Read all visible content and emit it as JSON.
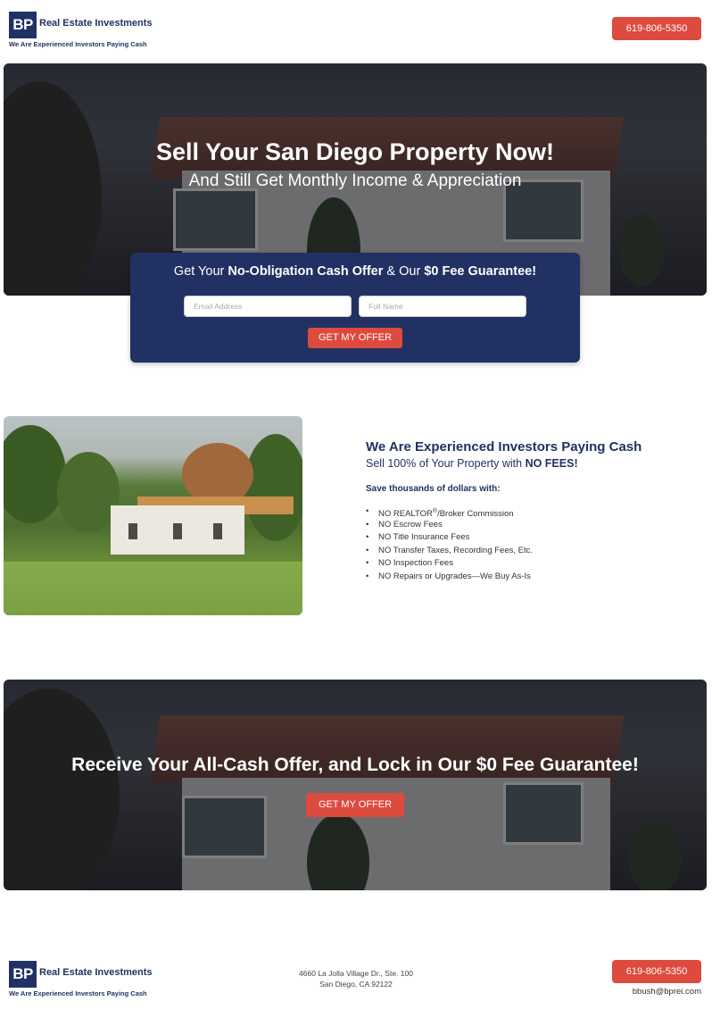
{
  "header": {
    "logo_mark": "BP",
    "logo_name": "Real Estate Investments",
    "logo_tagline": "We Are Experienced Investors Paying Cash",
    "phone": "619-806-5350"
  },
  "hero": {
    "title": "Sell Your San Diego Property Now!",
    "subtitle": "And Still Get Monthly Income & Appreciation"
  },
  "form": {
    "heading_pre": "Get Your ",
    "heading_bold1": "No-Obligation Cash Offer",
    "heading_mid": " & Our ",
    "heading_bold2": "$0 Fee Guarantee!",
    "email_placeholder": "Email Address",
    "name_placeholder": "Full Name",
    "submit_label": "GET MY OFFER"
  },
  "benefits": {
    "title": "We Are Experienced Investors Paying Cash",
    "subtitle_pre": "Sell 100% of Your Property with ",
    "subtitle_bold": "NO FEES!",
    "save_heading": "Save thousands of dollars with:",
    "item0_pre": "NO REALTOR",
    "item0_sup": "®",
    "item0_post": "/Broker Commission",
    "items": [
      "NO Escrow Fees",
      "NO Title Insurance Fees",
      "NO Transfer Taxes, Recording Fees, Etc.",
      "NO Inspection Fees",
      "NO Repairs or Upgrades—We Buy As-Is"
    ]
  },
  "banner": {
    "title": "Receive Your All-Cash Offer, and Lock in Our $0 Fee Guarantee!",
    "cta_label": "GET MY OFFER"
  },
  "footer": {
    "logo_mark": "BP",
    "logo_name": "Real Estate Investments",
    "logo_tagline": "We Are Experienced Investors Paying Cash",
    "address_line1": "4660 La Jolla Village Dr., Ste. 100",
    "address_line2": "San Diego, CA 92122",
    "phone": "619-806-5350",
    "email": "bbush@bprei.com"
  },
  "colors": {
    "navy": "#223163",
    "accent_red": "#dd4a3e"
  }
}
